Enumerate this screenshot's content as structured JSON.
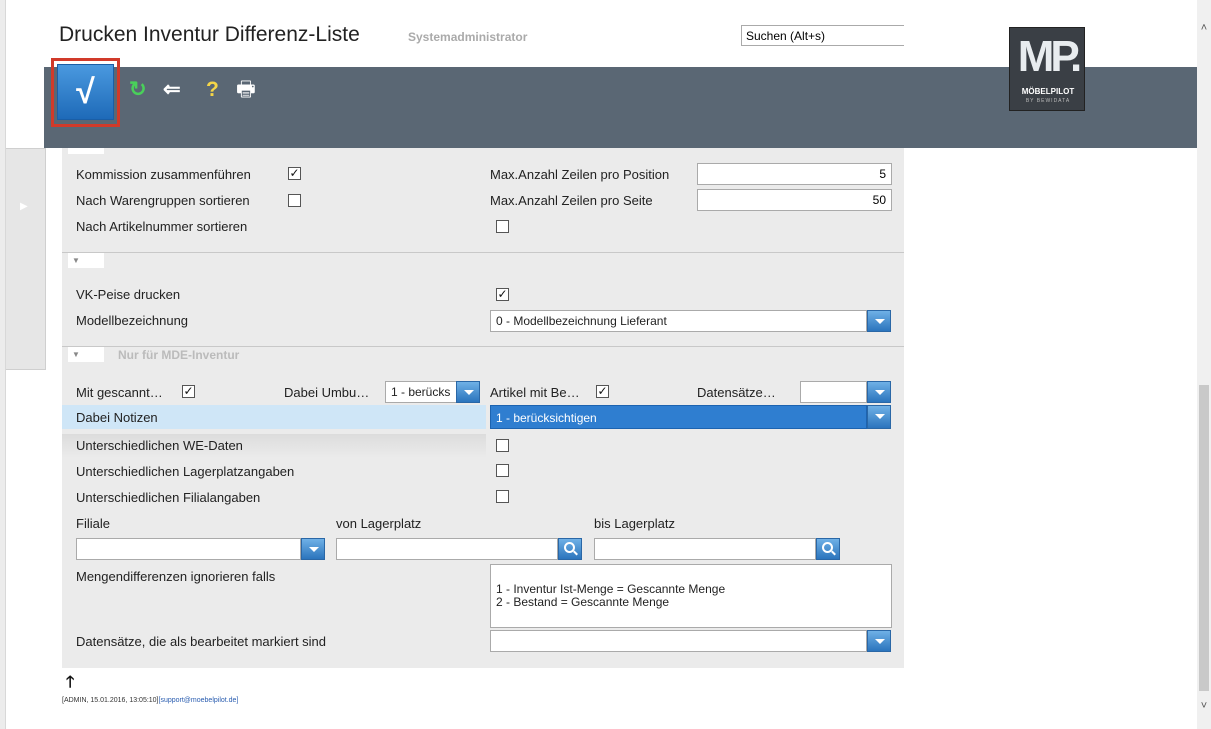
{
  "header": {
    "title": "Drucken Inventur Differenz-Liste",
    "user": "Systemadministrator",
    "search_value": "Suchen (Alt+s)"
  },
  "toolbar": {
    "confirm_glyph": "√",
    "refresh_glyph": "↻",
    "back_glyph": "⇐",
    "help_glyph": "?",
    "print_glyph": "🖶"
  },
  "logo": {
    "main": "MP.",
    "sub": "MÖBELPILOT",
    "tagline": "BY BEWIDATA"
  },
  "section1": {
    "kommission_label": "Kommission zusammenführen",
    "kommission_checked": "✓",
    "warengruppen_label": "Nach Warengruppen sortieren",
    "artikelnummer_label": "Nach Artikelnummer sortieren",
    "max_pos_label": "Max.Anzahl Zeilen pro Position",
    "max_pos_value": "5",
    "max_seite_label": "Max.Anzahl Zeilen pro Seite",
    "max_seite_value": "50"
  },
  "section2": {
    "vk_label": "VK-Peise drucken",
    "vk_checked": "✓",
    "modell_label": "Modellbezeichnung",
    "modell_value": "0 - Modellbezeichnung Lieferant"
  },
  "section3": {
    "title": "Nur für MDE-Inventur",
    "mit_gescannt_label": "Mit gescannt…",
    "mit_gescannt_checked": "✓",
    "dabei_umbu_label": "Dabei Umbu…",
    "dabei_umbu_value": "1 - berücks",
    "artikel_label": "Artikel mit Be…",
    "artikel_checked": "✓",
    "datensaetze_label": "Datensätze…",
    "notizen_label": "Dabei Notizen",
    "notizen_value": "1 - berücksichtigen",
    "we_label": "Unterschiedlichen WE-Daten",
    "lager_label": "Unterschiedlichen Lagerplatzangaben",
    "filial_label": "Unterschiedlichen Filialangaben",
    "filiale_label": "Filiale",
    "von_label": "von Lagerplatz",
    "bis_label": "bis Lagerplatz",
    "mengen_label": "Mengendifferenzen ignorieren falls",
    "mengen_line1": "1 - Inventur Ist-Menge = Gescannte Menge",
    "mengen_line2": "2 - Bestand = Gescannte Menge",
    "bearbeitet_label": "Datensätze, die als bearbeitet markiert sind"
  },
  "footer": {
    "arrow": "🡑",
    "info": "[ADMIN, 15.01.2016, 13:05:10]",
    "support": "[support@moebelpilot.de]"
  },
  "colors": {
    "toolbar_bg": "#5a6774",
    "accent_blue": "#2b74bd",
    "highlight_outline": "#d13a2a"
  }
}
